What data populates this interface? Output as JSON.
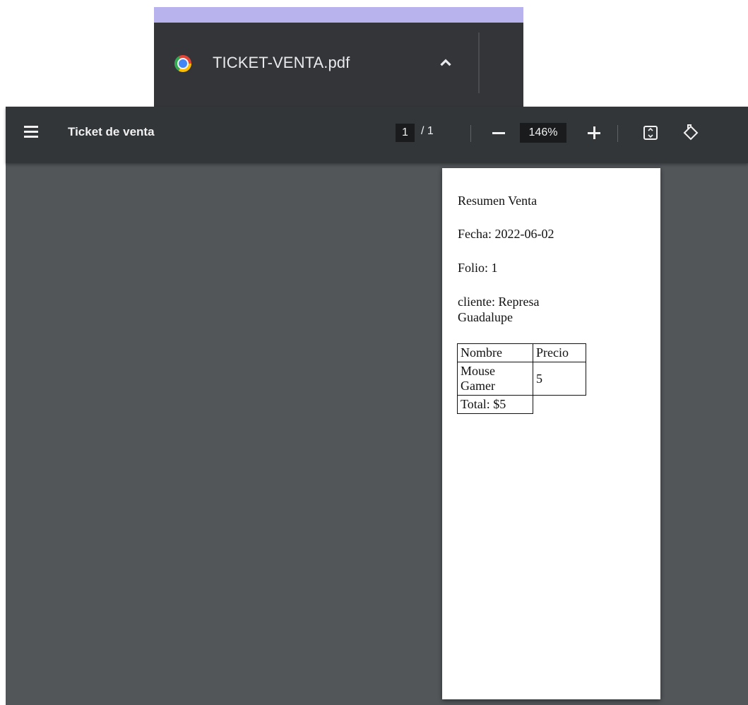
{
  "download_shelf": {
    "file_name": "TICKET-VENTA.pdf",
    "file_icon": "chrome-icon",
    "expand_icon": "chevron-up-icon"
  },
  "viewer": {
    "title": "Ticket de venta",
    "page": {
      "current": "1",
      "separator": "/ 1"
    },
    "zoom": "146%",
    "icons": [
      "menu-icon",
      "zoom-out-icon",
      "zoom-in-icon",
      "fit-page-icon",
      "rotate-icon"
    ]
  },
  "document": {
    "heading": "Resumen Venta",
    "date": "Fecha: 2022-06-02",
    "folio": "Folio: 1",
    "client": "cliente: Represa Guadalupe",
    "table": {
      "headers": [
        "Nombre",
        "Precio"
      ],
      "rows": [
        [
          "Mouse Gamer",
          "5"
        ]
      ],
      "total": "Total: $5"
    }
  }
}
